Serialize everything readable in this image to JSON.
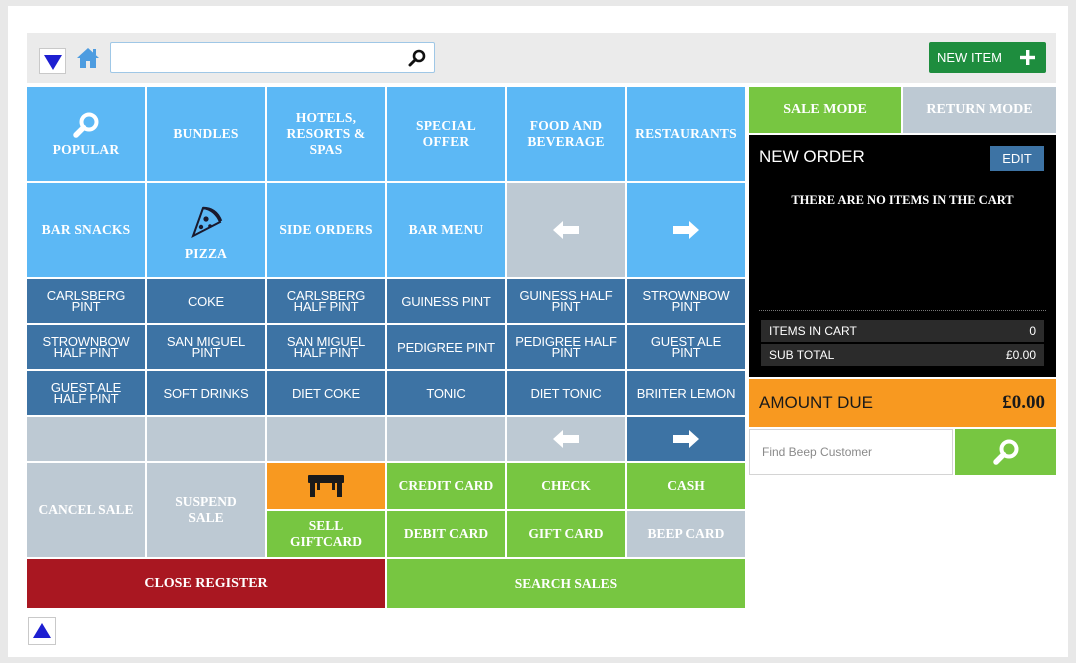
{
  "toolbar": {
    "search_value": "",
    "new_item_label": "NEW ITEM"
  },
  "categories": [
    "POPULAR",
    "BUNDLES",
    "HOTELS, RESORTS & SPAS",
    "SPECIAL OFFER",
    "FOOD AND BEVERAGE",
    "RESTAURANTS",
    "BAR SNACKS",
    "PIZZA",
    "SIDE ORDERS",
    "BAR MENU"
  ],
  "products": [
    "CARLSBERG PINT",
    "COKE",
    "CARLSBERG HALF PINT",
    "GUINESS PINT",
    "GUINESS HALF PINT",
    "STROWNBOW PINT",
    "STROWNBOW HALF PINT",
    "SAN MIGUEL PINT",
    "SAN MIGUEL HALF PINT",
    "PEDIGREE PINT",
    "PEDIGREE HALF PINT",
    "GUEST ALE PINT",
    "GUEST ALE HALF PINT",
    "SOFT DRINKS",
    "DIET COKE",
    "TONIC",
    "DIET TONIC",
    "BRIITER LEMON"
  ],
  "actions": {
    "cancel_sale": "CANCEL SALE",
    "suspend_sale": "SUSPEND SALE",
    "sell_giftcard": "SELL GIFTCARD",
    "credit_card": "CREDIT CARD",
    "check": "CHECK",
    "cash": "CASH",
    "debit_card": "DEBIT CARD",
    "gift_card": "GIFT CARD",
    "beep_card": "BEEP CARD",
    "close_register": "CLOSE REGISTER",
    "search_sales": "SEARCH SALES"
  },
  "cart": {
    "sale_mode": "SALE MODE",
    "return_mode": "RETURN MODE",
    "title": "NEW ORDER",
    "edit": "EDIT",
    "empty_message": "THERE ARE NO ITEMS IN THE CART",
    "items_label": "ITEMS IN CART",
    "items_value": "0",
    "subtotal_label": "SUB TOTAL",
    "subtotal_value": "£0.00",
    "amount_due_label": "AMOUNT DUE",
    "amount_due_value": "£0.00",
    "customer_placeholder": "Find Beep Customer"
  },
  "colors": {
    "category": "#5cb8f5",
    "product": "#3d73a4",
    "empty": "#bdc9d3",
    "green": "#77c641",
    "orange": "#f89920",
    "close_register": "#a91721",
    "new_item": "#1e8d3e"
  },
  "icons": [
    "chevron-down-icon",
    "home-icon",
    "search-icon",
    "plus-icon",
    "magnifier-icon",
    "pizza-icon",
    "arrow-left-icon",
    "arrow-right-icon",
    "table-icon",
    "chevron-up-icon"
  ]
}
